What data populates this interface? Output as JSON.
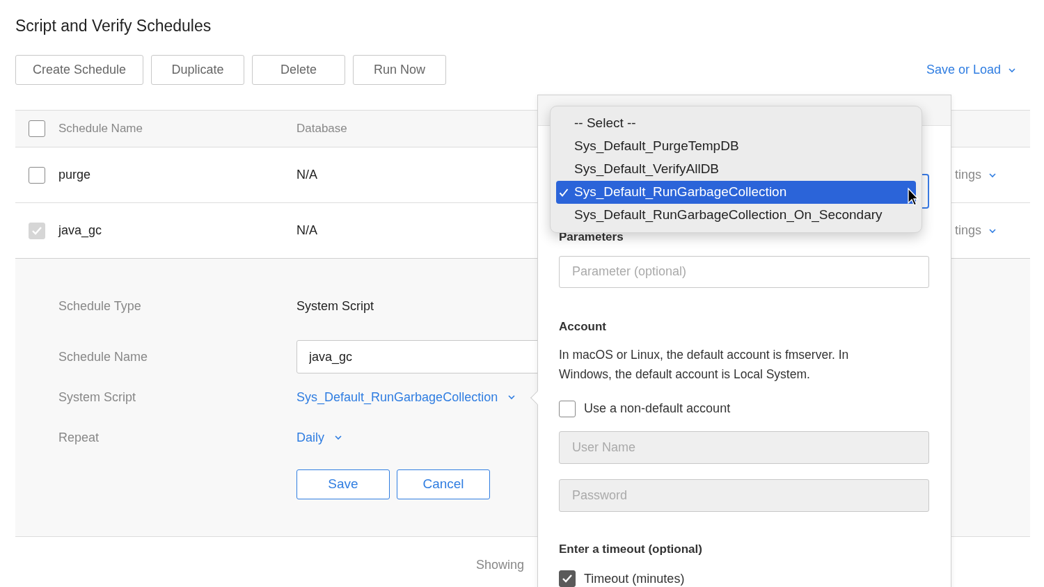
{
  "page": {
    "title": "Script and Verify Schedules"
  },
  "toolbar": {
    "buttons": [
      "Create Schedule",
      "Duplicate",
      "Delete",
      "Run Now"
    ],
    "save_or_load": "Save or Load"
  },
  "table": {
    "header": {
      "checked": false,
      "columns": [
        "Schedule Name",
        "Database"
      ]
    },
    "rows": [
      {
        "name": "purge",
        "database": "N/A",
        "checked": false,
        "disabled": false,
        "settings": "tings",
        "expanded": false
      },
      {
        "name": "java_gc",
        "database": "N/A",
        "checked": true,
        "disabled": true,
        "settings": "tings",
        "expanded": true
      }
    ],
    "details": {
      "fields": [
        {
          "kind": "text",
          "label": "Schedule Type",
          "value": "System Script"
        },
        {
          "kind": "input",
          "label": "Schedule Name",
          "value": "java_gc"
        },
        {
          "kind": "dropdown",
          "label": "System Script",
          "value": "Sys_Default_RunGarbageCollection"
        },
        {
          "kind": "dropdown",
          "label": "Repeat",
          "value": "Daily"
        }
      ],
      "buttons": [
        "Save",
        "Cancel"
      ]
    },
    "footer": "Showing"
  },
  "popover": {
    "script_menu": [
      {
        "label": "-- Select --",
        "selected": false
      },
      {
        "label": "Sys_Default_PurgeTempDB",
        "selected": false
      },
      {
        "label": "Sys_Default_VerifyAllDB",
        "selected": false
      },
      {
        "label": "Sys_Default_RunGarbageCollection",
        "selected": true
      },
      {
        "label": "Sys_Default_RunGarbageCollection_On_Secondary",
        "selected": false
      }
    ],
    "parameters": {
      "label": "Parameters",
      "placeholder": "Parameter (optional)"
    },
    "account": {
      "label": "Account",
      "description": "In macOS or Linux, the default account is fmserver. In Windows, the default account is Local System.",
      "non_default": {
        "label": "Use a non-default account",
        "checked": false
      },
      "username_placeholder": "User Name",
      "password_placeholder": "Password"
    },
    "timeout": {
      "label": "Enter a timeout (optional)",
      "checkbox": {
        "label": "Timeout (minutes)",
        "checked": true
      }
    }
  }
}
